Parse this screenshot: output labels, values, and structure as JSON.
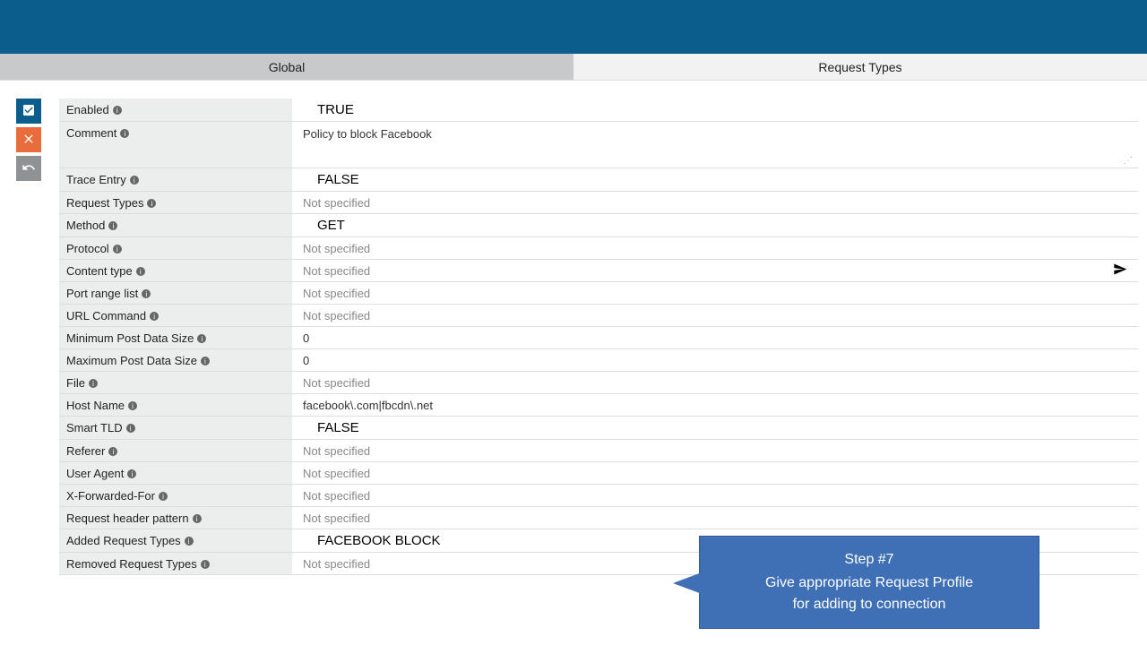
{
  "tabs": {
    "global": "Global",
    "request_types": "Request Types"
  },
  "fields": {
    "enabled": {
      "label": "Enabled",
      "value": "TRUE"
    },
    "comment": {
      "label": "Comment",
      "value": "Policy to block Facebook"
    },
    "trace_entry": {
      "label": "Trace Entry",
      "value": "FALSE"
    },
    "request_types": {
      "label": "Request Types",
      "value": "Not specified"
    },
    "method": {
      "label": "Method",
      "value": "GET"
    },
    "protocol": {
      "label": "Protocol",
      "value": "Not specified"
    },
    "content_type": {
      "label": "Content type",
      "value": "Not specified"
    },
    "port_range": {
      "label": "Port range list",
      "value": "Not specified"
    },
    "url_command": {
      "label": "URL Command",
      "value": "Not specified"
    },
    "min_post": {
      "label": "Minimum Post Data Size",
      "value": "0"
    },
    "max_post": {
      "label": "Maximum Post Data Size",
      "value": "0"
    },
    "file": {
      "label": "File",
      "value": "Not specified"
    },
    "host_name": {
      "label": "Host Name",
      "value": "facebook\\.com|fbcdn\\.net"
    },
    "smart_tld": {
      "label": "Smart TLD",
      "value": "FALSE"
    },
    "referer": {
      "label": "Referer",
      "value": "Not specified"
    },
    "user_agent": {
      "label": "User Agent",
      "value": "Not specified"
    },
    "x_forwarded": {
      "label": "X-Forwarded-For",
      "value": "Not specified"
    },
    "req_header": {
      "label": "Request header pattern",
      "value": "Not specified"
    },
    "added_req": {
      "label": "Added Request Types",
      "value": "FACEBOOK BLOCK"
    },
    "removed_req": {
      "label": "Removed Request Types",
      "value": "Not specified"
    }
  },
  "callout": {
    "title": "Step #7",
    "line1": "Give appropriate Request Profile",
    "line2": "for adding to connection"
  }
}
